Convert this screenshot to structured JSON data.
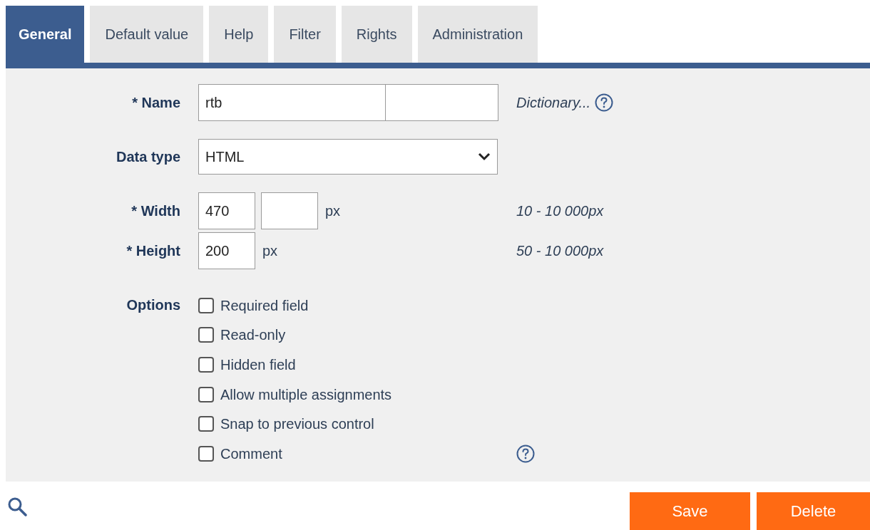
{
  "tabs": [
    {
      "label": "General",
      "selected": true
    },
    {
      "label": "Default value",
      "selected": false
    },
    {
      "label": "Help",
      "selected": false
    },
    {
      "label": "Filter",
      "selected": false
    },
    {
      "label": "Rights",
      "selected": false
    },
    {
      "label": "Administration",
      "selected": false
    }
  ],
  "name": {
    "label": "* Name",
    "value": "rtb",
    "link": "Dictionary..."
  },
  "data_type": {
    "label": "Data type",
    "value": "HTML"
  },
  "width": {
    "label": "* Width",
    "value": "470",
    "unit": "px",
    "hint": "10 - 10 000px"
  },
  "height": {
    "label": "* Height",
    "value": "200",
    "unit": "px",
    "hint": "50 - 10 000px"
  },
  "options": {
    "label": "Options",
    "items": [
      {
        "label": "Required field",
        "checked": false,
        "help": false
      },
      {
        "label": "Read-only",
        "checked": false,
        "help": false
      },
      {
        "label": "Hidden field",
        "checked": false,
        "help": false
      },
      {
        "label": "Allow multiple assignments",
        "checked": false,
        "help": false
      },
      {
        "label": "Snap to previous control",
        "checked": false,
        "help": false
      },
      {
        "label": "Comment",
        "checked": false,
        "help": true
      }
    ]
  },
  "buttons": [
    "Save",
    "Delete"
  ]
}
